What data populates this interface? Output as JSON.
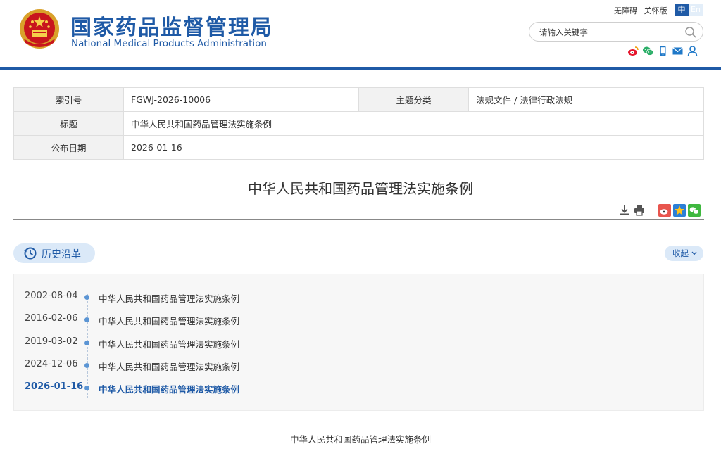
{
  "header": {
    "title_cn": "国家药品监督管理局",
    "title_en": "National Medical Products Administration",
    "top_links": [
      "无障碍",
      "关怀版"
    ],
    "lang_zh": "中",
    "lang_en": "En",
    "search_placeholder": "请输入关键字",
    "social_icons": [
      "weibo-icon",
      "wechat-icon",
      "mobile-icon",
      "mail-icon",
      "user-icon"
    ]
  },
  "info": {
    "index_label": "索引号",
    "index_value": "FGWJ-2026-10006",
    "category_label": "主题分类",
    "category_value": "法规文件 / 法律行政法规",
    "title_label": "标题",
    "title_value": "中华人民共和国药品管理法实施条例",
    "date_label": "公布日期",
    "date_value": "2026-01-16"
  },
  "document": {
    "title": "中华人民共和国药品管理法实施条例",
    "tools": [
      "download-icon",
      "print-icon",
      "share-weibo-icon",
      "share-qzone-icon",
      "share-wechat-icon"
    ]
  },
  "history": {
    "label": "历史沿革",
    "collapse_label": "收起",
    "items": [
      {
        "date": "2002-08-04",
        "text": "中华人民共和国药品管理法实施条例",
        "current": false
      },
      {
        "date": "2016-02-06",
        "text": "中华人民共和国药品管理法实施条例",
        "current": false
      },
      {
        "date": "2019-03-02",
        "text": "中华人民共和国药品管理法实施条例",
        "current": false
      },
      {
        "date": "2024-12-06",
        "text": "中华人民共和国药品管理法实施条例",
        "current": false
      },
      {
        "date": "2026-01-16",
        "text": "中华人民共和国药品管理法实施条例",
        "current": true
      }
    ]
  },
  "body": {
    "heading": "中华人民共和国药品管理法实施条例"
  },
  "colors": {
    "brand_blue": "#1f5aa6",
    "pill_bg": "#dbe9f8",
    "timeline_dot": "#5b95d4"
  }
}
